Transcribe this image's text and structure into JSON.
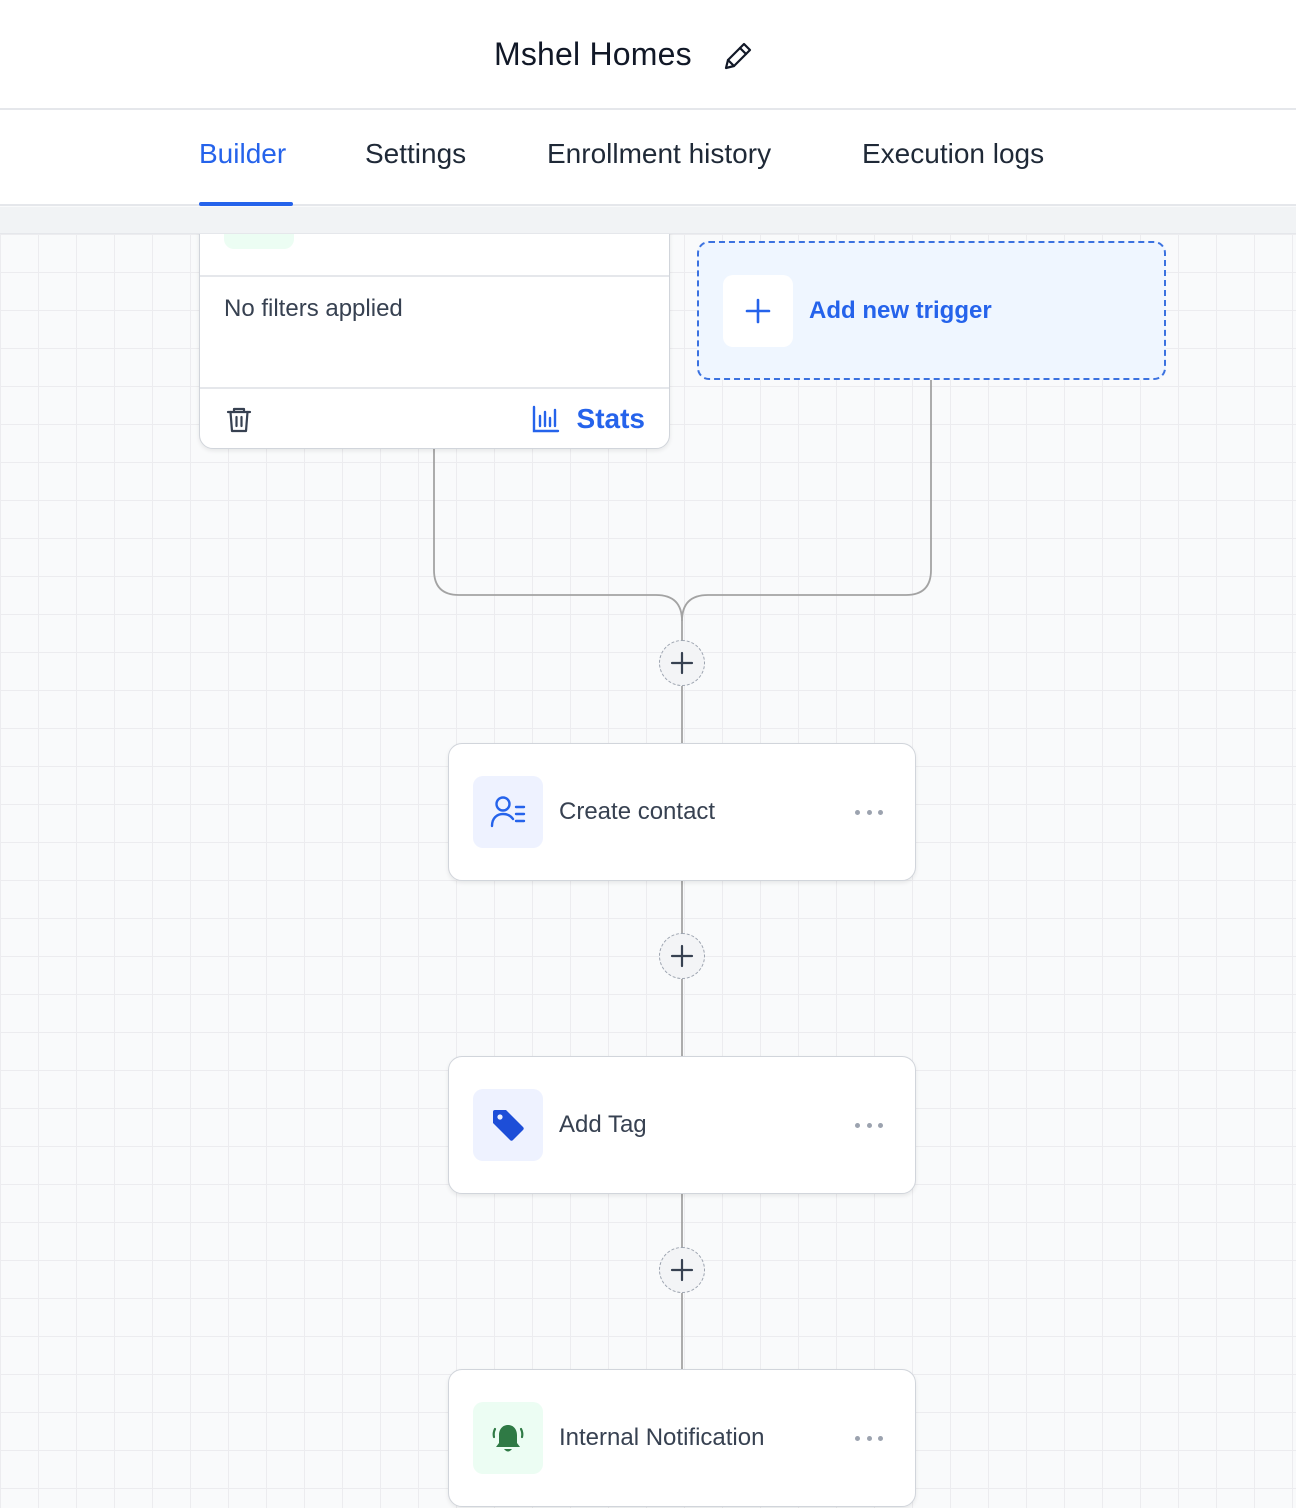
{
  "header": {
    "title": "Mshel Homes",
    "edit_icon": "pencil-icon"
  },
  "tabs": [
    {
      "label": "Builder",
      "active": true
    },
    {
      "label": "Settings",
      "active": false
    },
    {
      "label": "Enrollment history",
      "active": false
    },
    {
      "label": "Execution logs",
      "active": false
    }
  ],
  "trigger_card": {
    "filters_text": "No filters applied",
    "delete_icon": "trash-icon",
    "stats_label": "Stats",
    "stats_icon": "bar-chart-icon"
  },
  "add_trigger": {
    "label": "Add new trigger",
    "icon": "plus-icon"
  },
  "actions": [
    {
      "label": "Create contact",
      "icon": "contact-list-icon"
    },
    {
      "label": "Add Tag",
      "icon": "tag-icon"
    },
    {
      "label": "Internal Notification",
      "icon": "bell-icon"
    }
  ],
  "colors": {
    "accent": "#2563eb",
    "notification_green": "#2f7a45",
    "connector": "#a3a3a3"
  }
}
